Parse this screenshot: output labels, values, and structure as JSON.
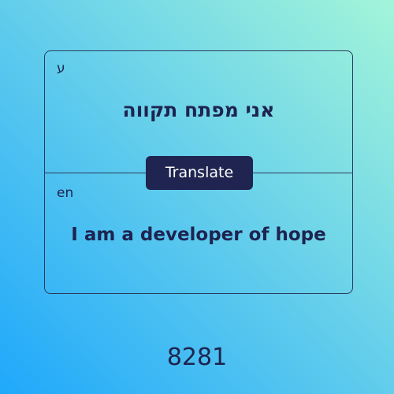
{
  "source": {
    "language": "ע",
    "text": "אני מפתח תקווה"
  },
  "target": {
    "language": "en",
    "text": "I am a developer of hope"
  },
  "translate_button": {
    "label": "Translate"
  },
  "counter": "8281"
}
